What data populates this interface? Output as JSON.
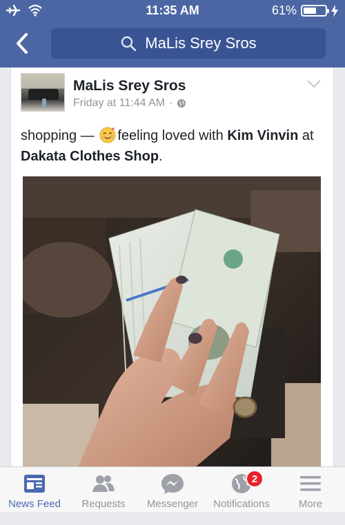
{
  "status_bar": {
    "time": "11:35 AM",
    "battery": "61%",
    "battery_level": 0.61
  },
  "nav": {
    "back_icon": "chevron-left-icon",
    "search_icon": "search-icon",
    "search_value": "MaLis Srey Sros"
  },
  "post": {
    "author": "MaLis Srey Sros",
    "time": "Friday at 11:44 AM",
    "separator": "·",
    "privacy_icon": "globe-icon",
    "text": {
      "activity": "shopping",
      "dash": "—",
      "feeling": "feeling loved with",
      "tag_person": "Kim Vinvin",
      "at": "at",
      "place": "Dakata Clothes Shop",
      "end": "."
    }
  },
  "tabs": [
    {
      "label": "News Feed",
      "icon": "news-feed-icon",
      "active": true
    },
    {
      "label": "Requests",
      "icon": "friend-requests-icon",
      "active": false
    },
    {
      "label": "Messenger",
      "icon": "messenger-icon",
      "active": false
    },
    {
      "label": "Notifications",
      "icon": "globe-icon",
      "active": false,
      "badge": "2"
    },
    {
      "label": "More",
      "icon": "menu-icon",
      "active": false
    }
  ],
  "colors": {
    "nav_blue": "#4c66a4",
    "active_tab": "#4b68b0",
    "badge_red": "#e8202b"
  }
}
